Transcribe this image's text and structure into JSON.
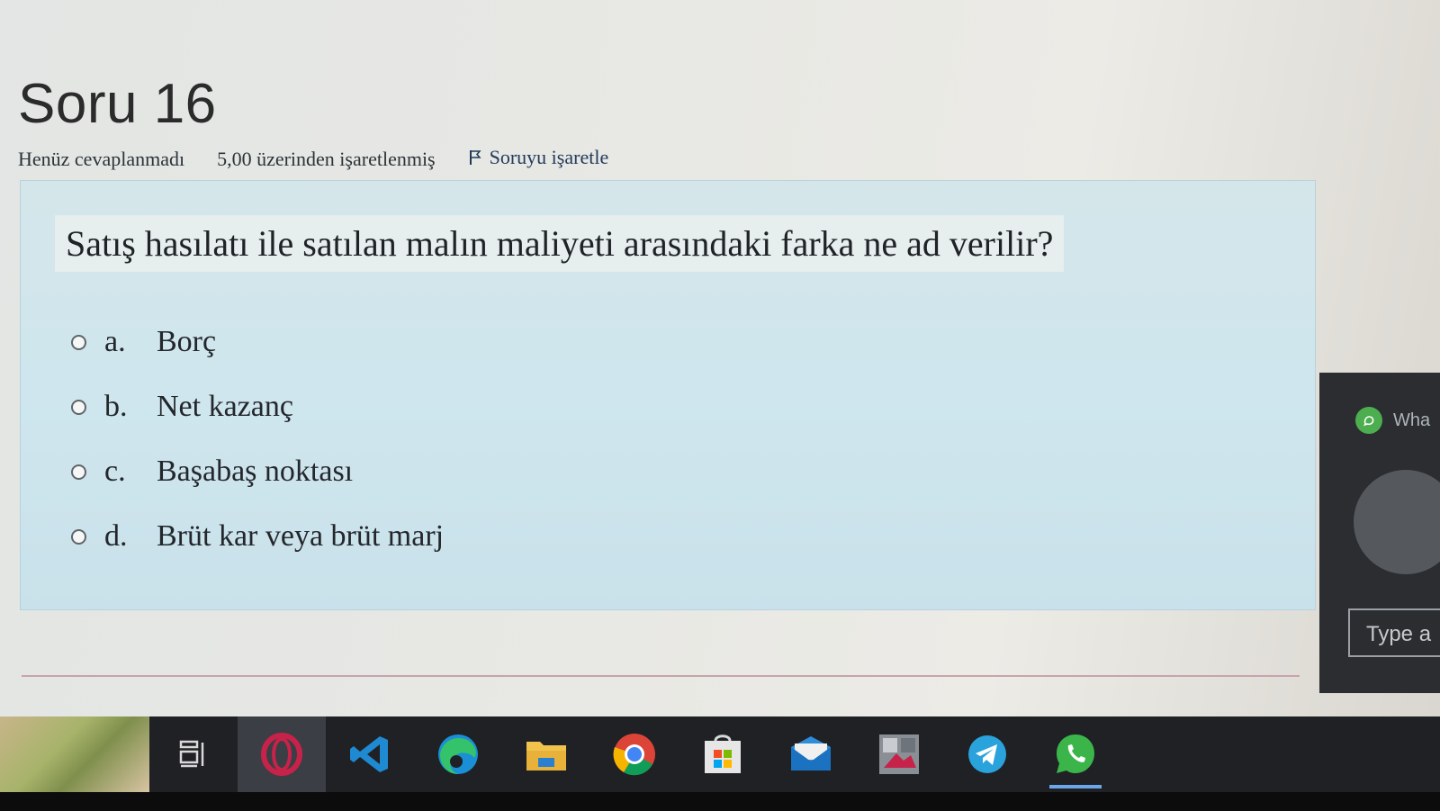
{
  "page": {
    "title": "Soru 16",
    "state": "Henüz cevaplanmadı",
    "grade": "5,00 üzerinden işaretlenmiş",
    "flag_label": "Soruyu işaretle"
  },
  "question": {
    "text": "Satış hasılatı ile satılan malın maliyeti arasındaki farka ne ad verilir?",
    "answers": [
      {
        "letter": "a.",
        "label": "Borç"
      },
      {
        "letter": "b.",
        "label": "Net kazanç"
      },
      {
        "letter": "c.",
        "label": "Başabaş noktası"
      },
      {
        "letter": "d.",
        "label": "Brüt kar veya brüt marj"
      }
    ]
  },
  "chat_panel": {
    "app_label": "Wha",
    "input_placeholder": "Type a"
  },
  "taskbar": {
    "icons": [
      "task-view-icon",
      "opera-icon",
      "vscode-icon",
      "edge-icon",
      "file-explorer-icon",
      "chrome-icon",
      "store-icon",
      "mail-icon",
      "photo-app-icon",
      "telegram-icon",
      "whatsapp-icon"
    ]
  },
  "colors": {
    "card_background": "#cfe6ee",
    "taskbar": "#1f2125",
    "accent": "#6ba6e8"
  }
}
